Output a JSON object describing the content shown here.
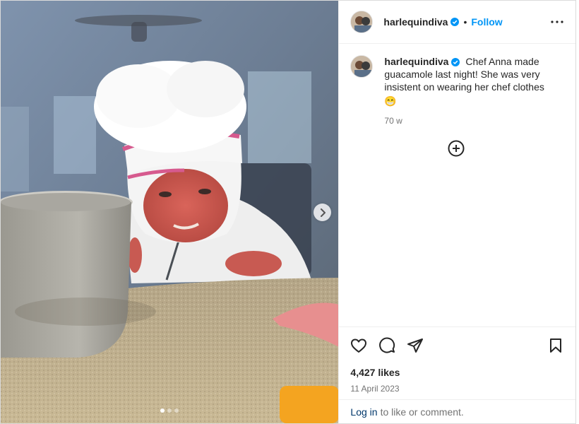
{
  "post": {
    "username": "harlequindiva",
    "separator": "•",
    "follow_label": "Follow",
    "caption": "Chef Anna made guacamole last night! She was very insistent on wearing her chef clothes",
    "caption_emoji": "😁",
    "time_ago": "70 w",
    "likes": "4,427 likes",
    "date": "11 April 2023",
    "login_link": "Log in",
    "login_suffix": "to like or comment.",
    "carousel_pages": 3,
    "carousel_active": 1
  },
  "icons": {
    "verified": "verified-badge-icon",
    "more": "more-options-icon",
    "load_more": "plus-circle-icon",
    "like": "heart-icon",
    "comment": "comment-bubble-icon",
    "share": "paper-plane-icon",
    "save": "bookmark-icon",
    "next": "chevron-right-icon"
  },
  "colors": {
    "accent": "#0095f6",
    "verified": "#0095f6",
    "link": "#00376b",
    "muted": "#737373"
  }
}
